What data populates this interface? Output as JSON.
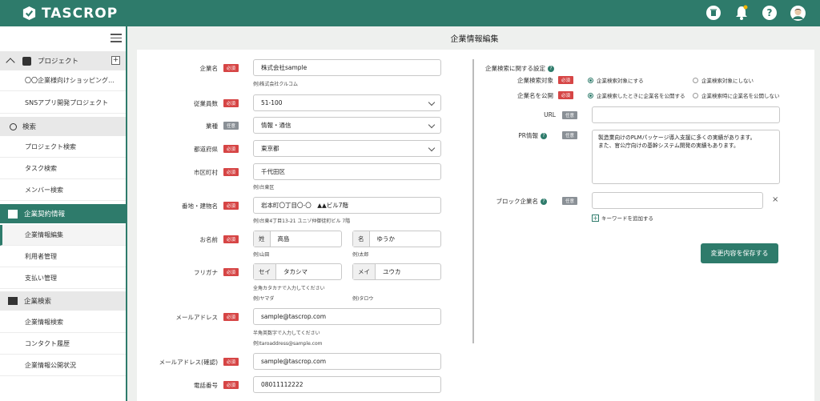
{
  "app": {
    "title": "TASCROP"
  },
  "header": {
    "title": "企業情報編集"
  },
  "sidebar": {
    "project_section": "プロジェクト",
    "projects": [
      "〇〇企業様向けショッピング…",
      "SNSアプリ開発プロジェクト"
    ],
    "search_section": "検索",
    "search_items": [
      "プロジェクト検索",
      "タスク検索",
      "メンバー検索"
    ],
    "contract_section": "企業契約情報",
    "contract_items": [
      "企業情報編集",
      "利用者管理",
      "支払い管理"
    ],
    "company_search_section": "企業検索",
    "company_search_items": [
      "企業情報検索",
      "コンタクト履歴",
      "企業情報公開状況"
    ]
  },
  "badges": {
    "required": "必須",
    "optional": "任意"
  },
  "form": {
    "company_name": {
      "label": "企業名",
      "value": "株式会社sample",
      "hint": "例)株式会社クルコム"
    },
    "employees": {
      "label": "従業員数",
      "value": "51-100"
    },
    "industry": {
      "label": "業種",
      "value": "情報・通信"
    },
    "prefecture": {
      "label": "都道府県",
      "value": "東京都"
    },
    "city": {
      "label": "市区町村",
      "value": "千代田区",
      "hint": "例)台東区"
    },
    "address": {
      "label": "番地・建物名",
      "value": "岩本町〇丁目〇-〇　▲▲ビル7階",
      "hint": "例)台東4丁目13-21 ユニゾ仲御徒町ビル 7階"
    },
    "name": {
      "label": "お名前",
      "last_prefix": "姓",
      "last_value": "高島",
      "last_hint": "例)山田",
      "first_prefix": "名",
      "first_value": "ゆうか",
      "first_hint": "例)太郎"
    },
    "furigana": {
      "label": "フリガナ",
      "last_prefix": "セイ",
      "last_value": "タカシマ",
      "last_hint1": "全角カタカナで入力してください",
      "last_hint2": "例)ヤマダ",
      "first_prefix": "メイ",
      "first_value": "ユウカ",
      "first_hint": "例)タロウ"
    },
    "email": {
      "label": "メールアドレス",
      "value": "sample@tascrop.com",
      "hint1": "半角英数字で入力してください",
      "hint2": "例)taroaddress@sample.com"
    },
    "email_confirm": {
      "label": "メールアドレス(確認)",
      "value": "sample@tascrop.com"
    },
    "phone": {
      "label": "電話番号",
      "value": "08011112222"
    }
  },
  "search_settings": {
    "title": "企業検索に関する設定",
    "target": {
      "label": "企業検索対象",
      "option_on": "企業検索対象にする",
      "option_off": "企業検索対象にしない"
    },
    "publish": {
      "label": "企業名を公開",
      "option_on": "企業検索したときに企業名を公開する",
      "option_off": "企業検索時に企業名を公開しない"
    },
    "url": {
      "label": "URL",
      "value": ""
    },
    "pr": {
      "label": "PR情報",
      "value": "製造業向けのPLMパッケージ導入支援に多くの実績があります。\nまた、官公庁向けの基幹システム開発の実績もあります。"
    },
    "block": {
      "label": "ブロック企業名",
      "value": "",
      "add_keyword": "キーワードを追加する"
    },
    "save_label": "変更内容を保存する"
  }
}
